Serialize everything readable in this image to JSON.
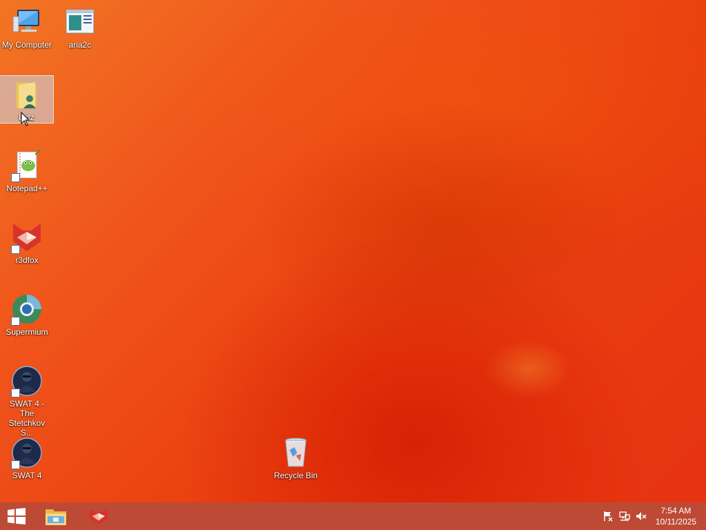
{
  "desktop": {
    "icons": [
      {
        "label": "My Computer",
        "icon": "computer-icon"
      },
      {
        "label": "aria2c",
        "icon": "application-window-icon"
      },
      {
        "label": "Lirtz",
        "icon": "user-folder-icon"
      },
      {
        "label": "Notepad++",
        "icon": "notepad-plus-plus-icon"
      },
      {
        "label": "r3dfox",
        "icon": "r3dfox-icon"
      },
      {
        "label": "Supermium",
        "icon": "supermium-browser-icon"
      },
      {
        "label": "SWAT 4 - The Stetchkov S...",
        "icon": "swat4-game-icon"
      },
      {
        "label": "SWAT 4",
        "icon": "swat4-game-icon"
      },
      {
        "label": "Recycle Bin",
        "icon": "recycle-bin-icon"
      }
    ]
  },
  "taskbar": {
    "start": "windows-start-icon",
    "pinned": [
      "file-explorer-icon",
      "r3dfox-icon"
    ],
    "tray": [
      "action-center-flag-icon",
      "network-icon",
      "volume-muted-icon"
    ],
    "time": "7:54 AM",
    "date": "10/11/2025"
  },
  "colors": {
    "taskbar": "#bd4a35",
    "wallpaper": "#f0541b"
  }
}
